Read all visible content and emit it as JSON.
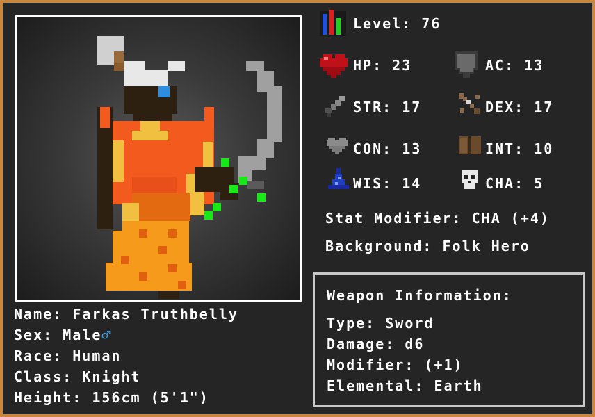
{
  "level": {
    "label": "Level:",
    "value": "76"
  },
  "stats": {
    "hp": {
      "label": "HP:",
      "value": "23"
    },
    "ac": {
      "label": "AC:",
      "value": "13"
    },
    "str": {
      "label": "STR:",
      "value": "17"
    },
    "dex": {
      "label": "DEX:",
      "value": "17"
    },
    "con": {
      "label": "CON:",
      "value": "13"
    },
    "int": {
      "label": "INT:",
      "value": "10"
    },
    "wis": {
      "label": "WIS:",
      "value": "14"
    },
    "cha": {
      "label": "CHA:",
      "value": "5"
    }
  },
  "stat_modifier": {
    "label": "Stat Modifier:",
    "value": "CHA (+4)"
  },
  "background": {
    "label": "Background:",
    "value": "Folk Hero"
  },
  "character": {
    "name": {
      "label": "Name:",
      "value": "Farkas Truthbelly"
    },
    "sex": {
      "label": "Sex:",
      "value": "Male",
      "symbol": "♂"
    },
    "race": {
      "label": "Race:",
      "value": "Human"
    },
    "class": {
      "label": "Class:",
      "value": "Knight"
    },
    "height": {
      "label": "Height:",
      "value": "156cm (5'1\")"
    }
  },
  "weapon": {
    "title": "Weapon Information:",
    "type": {
      "label": "Type:",
      "value": "Sword"
    },
    "damage": {
      "label": "Damage:",
      "value": "d6"
    },
    "modifier": {
      "label": "Modifier:",
      "value": "(+1)"
    },
    "elemental": {
      "label": "Elemental:",
      "value": "Earth"
    }
  },
  "icons": {
    "level": "bar-chart-icon",
    "hp": "heart-icon",
    "ac": "shield-icon",
    "str": "sword-icon",
    "dex": "bow-icon",
    "con": "gray-heart-icon",
    "int": "book-icon",
    "wis": "wizard-hat-icon",
    "cha": "skull-icon"
  },
  "colors": {
    "border": "#c8873c",
    "background": "#252525",
    "male_symbol": "#3aa0e8"
  }
}
